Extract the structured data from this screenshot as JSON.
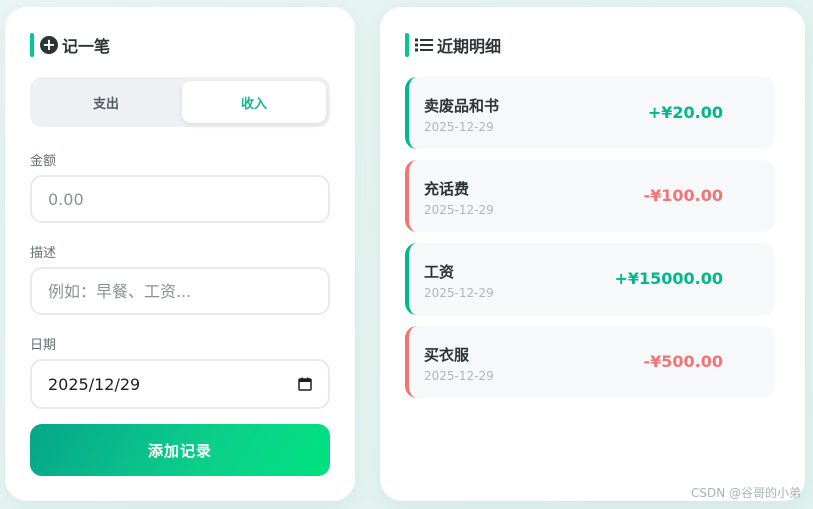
{
  "form": {
    "title": "记一笔",
    "tabs": [
      {
        "label": "支出",
        "active": false
      },
      {
        "label": "收入",
        "active": true
      }
    ],
    "amount_label": "金额",
    "amount_placeholder": "0.00",
    "description_label": "描述",
    "description_placeholder": "例如：早餐、工资...",
    "date_label": "日期",
    "date_value": "2025/12/29",
    "submit_label": "添加记录"
  },
  "records": {
    "title": "近期明细",
    "items": [
      {
        "title": "卖废品和书",
        "date": "2025-12-29",
        "amount": "+¥20.00",
        "type": "income"
      },
      {
        "title": "充话费",
        "date": "2025-12-29",
        "amount": "-¥100.00",
        "type": "expense"
      },
      {
        "title": "工资",
        "date": "2025-12-29",
        "amount": "+¥15000.00",
        "type": "income"
      },
      {
        "title": "买衣服",
        "date": "2025-12-29",
        "amount": "-¥500.00",
        "type": "expense"
      }
    ]
  },
  "colors": {
    "income": "#00b98a",
    "expense": "#f07575",
    "accent": "#00c98d"
  },
  "watermark": "CSDN @谷哥的小弟"
}
